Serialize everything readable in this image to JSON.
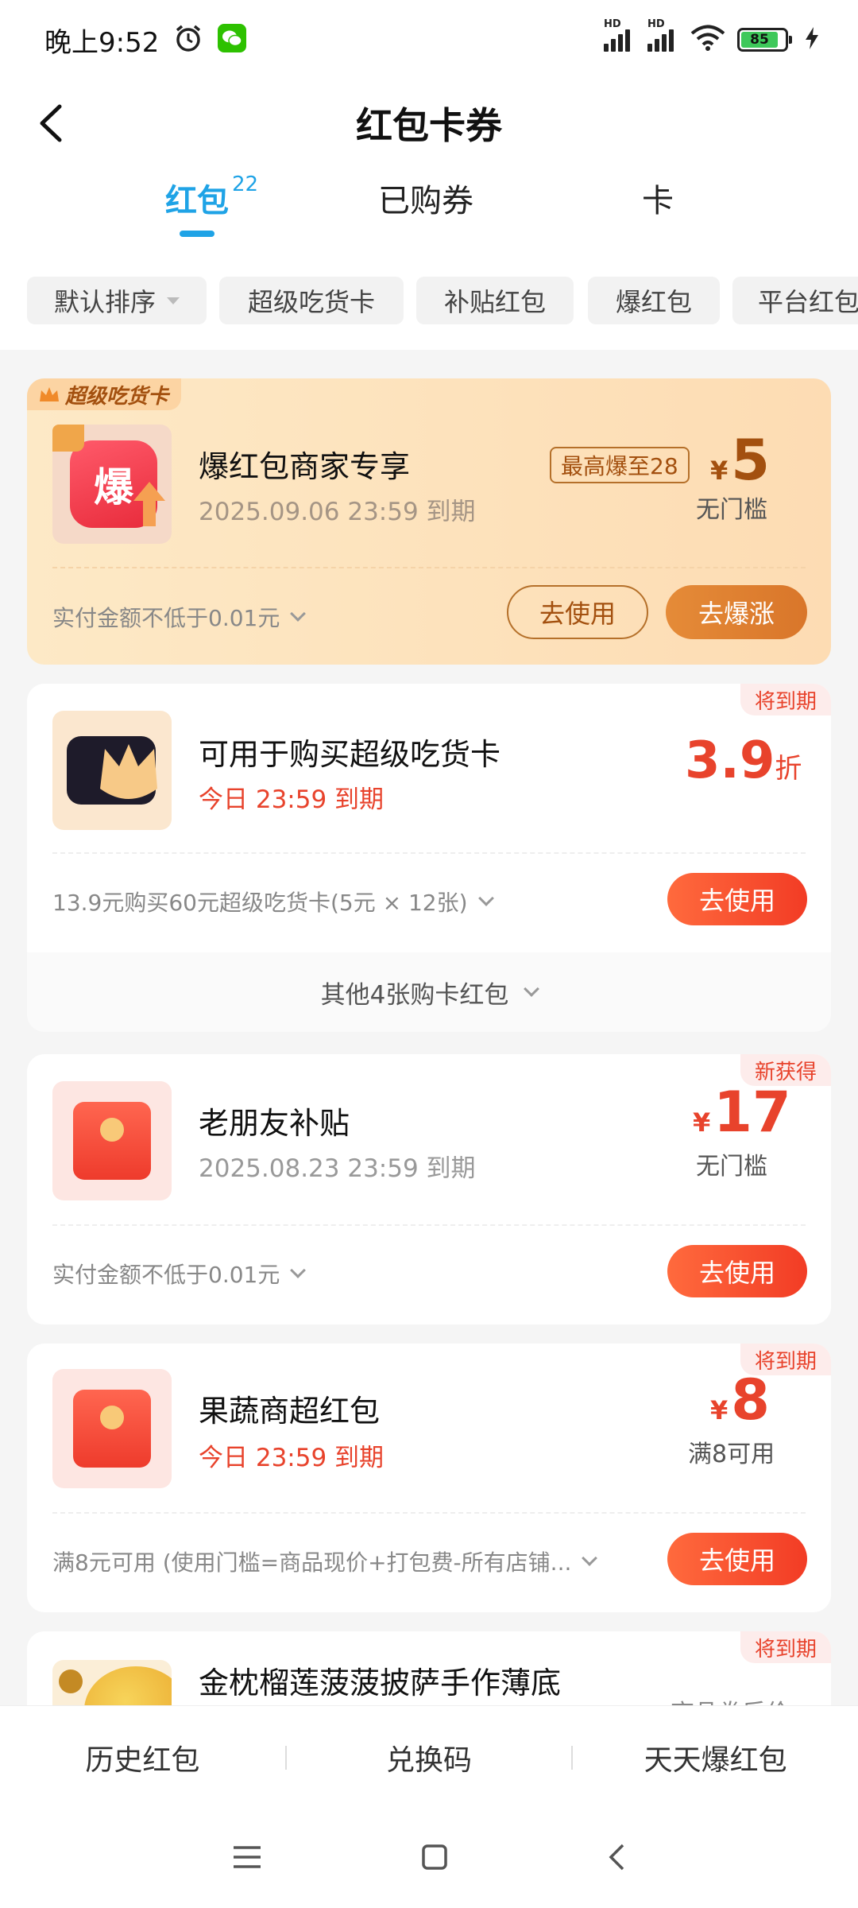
{
  "status_bar": {
    "time": "晚上9:52",
    "battery": "85",
    "hd1": "HD",
    "hd2": "HD"
  },
  "nav": {
    "title": "红包卡券"
  },
  "tabs": [
    {
      "label": "红包",
      "badge": "22",
      "active": true
    },
    {
      "label": "已购券"
    },
    {
      "label": "卡"
    }
  ],
  "filters": [
    "默认排序",
    "超级吃货卡",
    "补贴红包",
    "爆红包",
    "平台红包"
  ],
  "cards": {
    "explosion": {
      "ribbon": "超级吃货卡",
      "title": "爆红包商家专享",
      "expiry": "2025.09.06 23:59 到期",
      "badge": "最高爆至28",
      "amount_yen": "¥",
      "amount": "5",
      "condition": "无门槛",
      "rule": "实付金额不低于0.01元",
      "thumb_char": "爆",
      "btn_use": "去使用",
      "btn_boost": "去爆涨"
    },
    "cardbuy": {
      "corner": "将到期",
      "title": "可用于购买超级吃货卡",
      "expiry": "今日 23:59 到期",
      "amount": "3.9",
      "unit": "折",
      "rule": "13.9元购买60元超级吃货卡(5元 × 12张)",
      "btn_use": "去使用",
      "more": "其他4张购卡红包"
    },
    "oldfriend": {
      "corner": "新获得",
      "title": "老朋友补贴",
      "expiry": "2025.08.23 23:59 到期",
      "amount_yen": "¥",
      "amount": "17",
      "condition": "无门槛",
      "rule": "实付金额不低于0.01元",
      "btn_use": "去使用"
    },
    "fruit": {
      "corner": "将到期",
      "title": "果蔬商超红包",
      "expiry": "今日 23:59 到期",
      "amount_yen": "¥",
      "amount": "8",
      "condition": "满8可用",
      "rule": "满8元可用 (使用门槛=商品现价+打包费-所有店铺...",
      "btn_use": "去使用"
    },
    "durian": {
      "corner": "将到期",
      "title": "金枕榴莲菠菠披萨手作薄底",
      "price_note": "商品券后价"
    }
  },
  "bottom_bar": [
    "历史红包",
    "兑换码",
    "天天爆红包"
  ],
  "colors": {
    "accent_blue": "#1fa3e6",
    "accent_red": "#e8432c",
    "gold": "#a3500f"
  }
}
